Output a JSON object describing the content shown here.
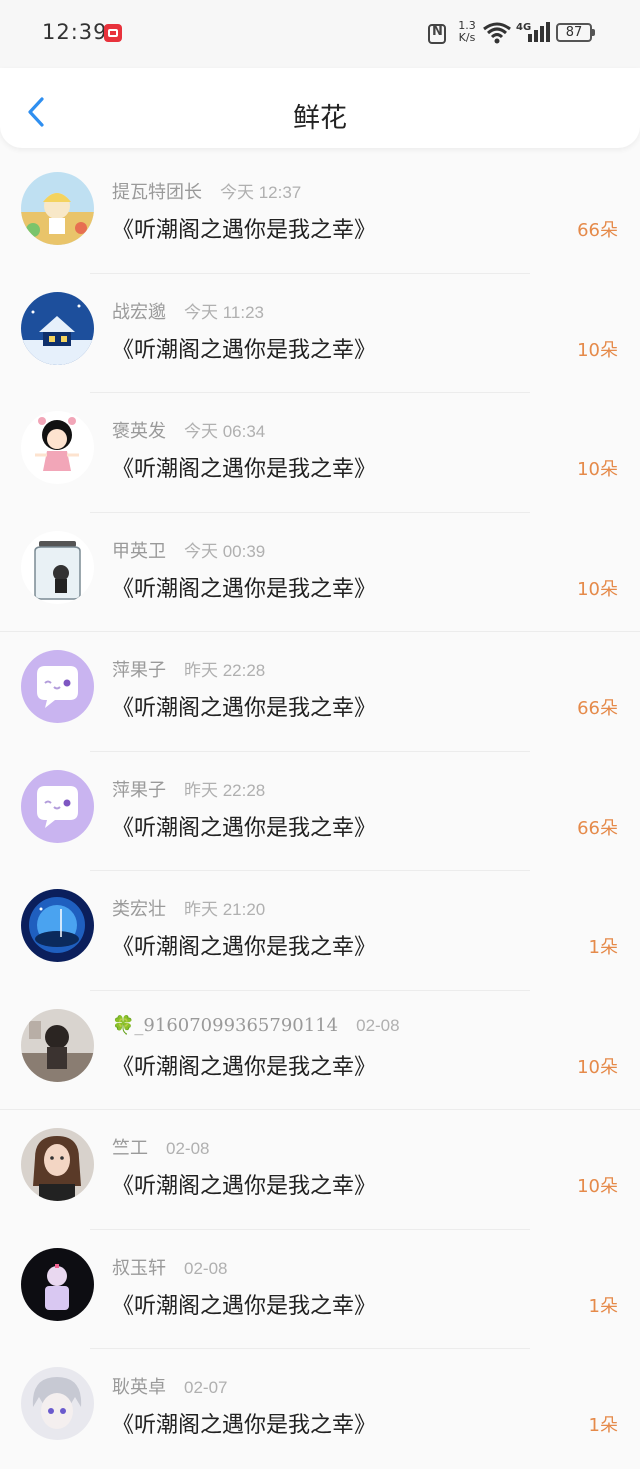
{
  "status": {
    "time": "12:39",
    "speed_top": "1.3",
    "speed_bottom": "K/s",
    "network": "4G",
    "battery": "87"
  },
  "header": {
    "title": "鲜花"
  },
  "colors": {
    "accent": "#2f8ff0",
    "count": "#e58a4a"
  },
  "items": [
    {
      "name": "提瓦特团长",
      "time": "今天 12:37",
      "book": "《听潮阁之遇你是我之幸》",
      "count": "66朵"
    },
    {
      "name": "战宏邈",
      "time": "今天 11:23",
      "book": "《听潮阁之遇你是我之幸》",
      "count": "10朵"
    },
    {
      "name": "褒英发",
      "time": "今天 06:34",
      "book": "《听潮阁之遇你是我之幸》",
      "count": "10朵"
    },
    {
      "name": "甲英卫",
      "time": "今天 00:39",
      "book": "《听潮阁之遇你是我之幸》",
      "count": "10朵"
    },
    {
      "name": "萍果子",
      "time": "昨天 22:28",
      "book": "《听潮阁之遇你是我之幸》",
      "count": "66朵"
    },
    {
      "name": "萍果子",
      "time": "昨天 22:28",
      "book": "《听潮阁之遇你是我之幸》",
      "count": "66朵"
    },
    {
      "name": "类宏壮",
      "time": "昨天 21:20",
      "book": "《听潮阁之遇你是我之幸》",
      "count": "1朵"
    },
    {
      "name": "🍀_91607099365790114",
      "time": "02-08",
      "book": "《听潮阁之遇你是我之幸》",
      "count": "10朵"
    },
    {
      "name": "竺工",
      "time": "02-08",
      "book": "《听潮阁之遇你是我之幸》",
      "count": "10朵"
    },
    {
      "name": "叔玉轩",
      "time": "02-08",
      "book": "《听潮阁之遇你是我之幸》",
      "count": "1朵"
    },
    {
      "name": "耿英卓",
      "time": "02-07",
      "book": "《听潮阁之遇你是我之幸》",
      "count": "1朵"
    }
  ]
}
